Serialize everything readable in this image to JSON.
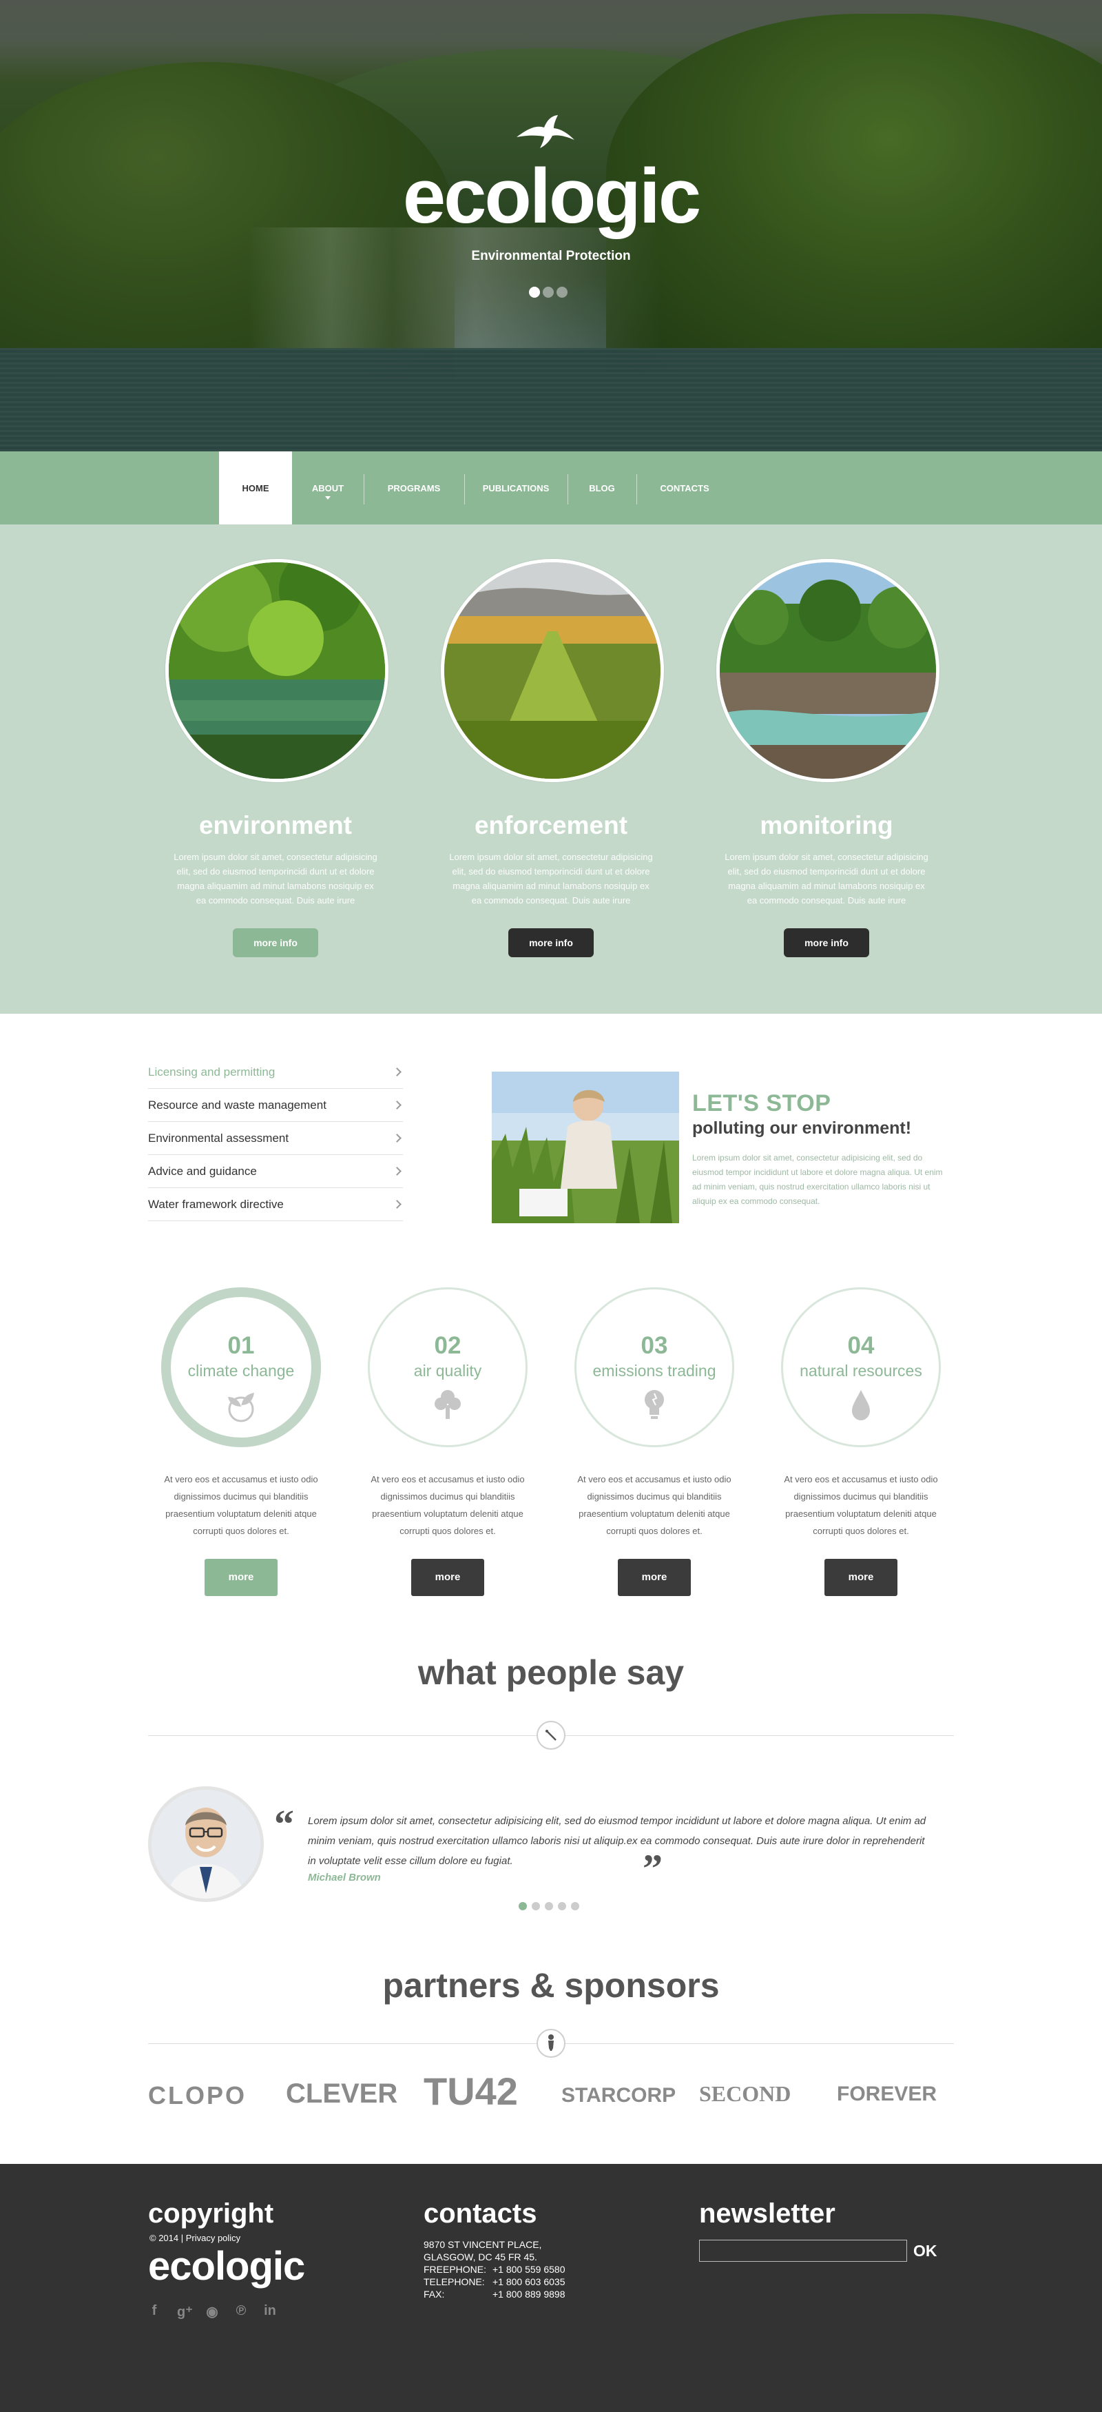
{
  "hero": {
    "logo": "ecologic",
    "subtitle": "Environmental Protection",
    "slides": 3,
    "active_slide": 1
  },
  "nav": {
    "items": [
      {
        "label": "HOME",
        "active": true
      },
      {
        "label": "ABOUT",
        "has_dropdown": true
      },
      {
        "label": "PROGRAMS"
      },
      {
        "label": "PUBLICATIONS"
      },
      {
        "label": "BLOG"
      },
      {
        "label": "CONTACTS"
      }
    ]
  },
  "services": [
    {
      "title": "environment",
      "text": "Lorem ipsum dolor sit amet, consectetur adipisicing elit, sed do eiusmod temporincidi dunt ut et dolore magna aliquamim ad minut lamabons nosiquip ex ea commodo consequat. Duis aute irure",
      "button": "more info",
      "button_style": "green"
    },
    {
      "title": "enforcement",
      "text": "Lorem ipsum dolor sit amet, consectetur adipisicing elit, sed do eiusmod temporincidi dunt ut et dolore magna aliquamim ad minut lamabons nosiquip ex ea commodo consequat. Duis aute irure",
      "button": "more info",
      "button_style": "dark"
    },
    {
      "title": "monitoring",
      "text": "Lorem ipsum dolor sit amet, consectetur adipisicing elit, sed do eiusmod temporincidi dunt ut et dolore magna aliquamim ad minut lamabons nosiquip ex ea commodo consequat. Duis aute irure",
      "button": "more info",
      "button_style": "dark"
    }
  ],
  "side_list": {
    "items": [
      {
        "label": "Licensing and permitting",
        "active": true
      },
      {
        "label": "Resource and waste management"
      },
      {
        "label": "Environmental assessment"
      },
      {
        "label": "Advice and guidance"
      },
      {
        "label": "Water framework directive"
      }
    ]
  },
  "lets_stop": {
    "title1": "LET'S STOP",
    "title2": "polluting our environment!",
    "text": "Lorem ipsum dolor sit amet, consectetur adipisicing elit, sed do eiusmod tempor incididunt ut labore et dolore magna aliqua. Ut enim ad minim veniam, quis nostrud exercitation ullamco laboris nisi ut aliquip ex ea commodo consequat."
  },
  "features": [
    {
      "num": "01",
      "label": "climate change",
      "icon": "plant-globe-icon",
      "text": "At vero eos et accusamus et iusto odio dignissimos ducimus qui blanditiis praesentium voluptatum deleniti atque corrupti quos dolores et.",
      "button": "more",
      "highlight": true
    },
    {
      "num": "02",
      "label": "air quality",
      "icon": "tree-icon",
      "text": "At vero eos et accusamus et iusto odio dignissimos ducimus qui blanditiis praesentium voluptatum deleniti atque corrupti quos dolores et.",
      "button": "more"
    },
    {
      "num": "03",
      "label": "emissions trading",
      "icon": "lightbulb-icon",
      "text": "At vero eos et accusamus et iusto odio dignissimos ducimus qui blanditiis praesentium voluptatum deleniti atque corrupti quos dolores et.",
      "button": "more"
    },
    {
      "num": "04",
      "label": "natural resources",
      "icon": "water-drop-icon",
      "text": "At vero eos et accusamus et iusto odio dignissimos ducimus qui blanditiis praesentium voluptatum deleniti atque corrupti quos dolores et.",
      "button": "more"
    }
  ],
  "testimonials": {
    "title": "what people say",
    "quote": "Lorem ipsum dolor sit amet, consectetur adipisicing elit, sed do eiusmod tempor incididunt ut labore et dolore magna aliqua. Ut enim ad minim veniam, quis nostrud exercitation ullamco laboris nisi ut aliquip.ex ea commodo consequat. Duis aute irure dolor in reprehenderit in voluptate velit esse cillum dolore eu fugiat.",
    "author": "Michael Brown",
    "dots": 5,
    "active_dot": 0
  },
  "partners": {
    "title": "partners & sponsors",
    "logos": [
      "CLOPO",
      "CLEVER",
      "TU42",
      "STARCORP",
      "SECOND",
      "FOREVER"
    ]
  },
  "footer": {
    "copyright_title": "copyright",
    "copyright_text": "© 2014 | Privacy policy",
    "logo": "ecologic",
    "social": [
      "facebook-icon",
      "google-plus-icon",
      "rss-icon",
      "pinterest-icon",
      "linkedin-icon"
    ],
    "contacts_title": "contacts",
    "address1": "9870 ST VINCENT PLACE,",
    "address2": "GLASGOW, DC 45 FR 45.",
    "phones": [
      {
        "k": "FREEPHONE:",
        "v": "+1 800 559 6580"
      },
      {
        "k": "TELEPHONE:",
        "v": "+1 800 603 6035"
      },
      {
        "k": "FAX:",
        "v": "+1 800 889 9898"
      }
    ],
    "newsletter_title": "newsletter",
    "newsletter_value": "",
    "newsletter_button": "OK"
  },
  "colors": {
    "accent": "#8db896",
    "dark": "#2d2d2d",
    "footer": "#333333",
    "services_bg": "#c5d9cb"
  }
}
